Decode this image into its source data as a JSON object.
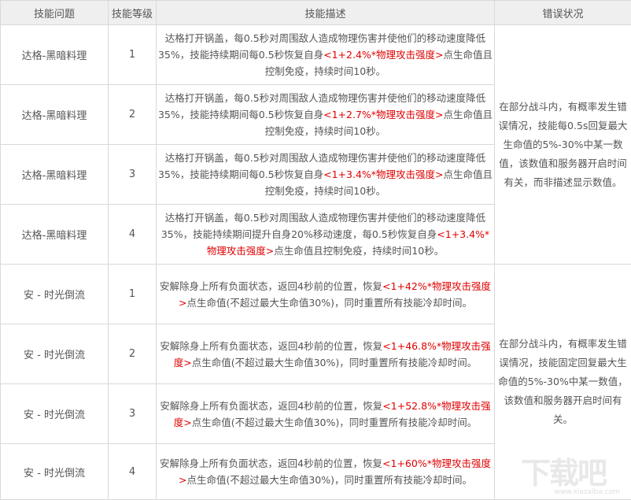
{
  "headers": [
    "技能问题",
    "技能等级",
    "技能描述",
    "错误状况"
  ],
  "groups": [
    {
      "issue": "在部分战斗内，有概率发生错误情况，技能每0.5s回复最大生命值的5%-30%中某一数值，该数值和服务器开启时间有关，而非描述显示数值。",
      "rows": [
        {
          "skill": "达格-黑暗料理",
          "level": "1",
          "desc_pre": "达格打开锅盖，每0.5秒对周围敌人造成物理伤害并使他们的移动速度降低35%，技能持续期间每0.5秒恢复自身",
          "desc_red": "<1+2.4%*物理攻击强度>",
          "desc_post": "点生命值且控制免疫，持续时间10秒。"
        },
        {
          "skill": "达格-黑暗料理",
          "level": "2",
          "desc_pre": "达格打开锅盖，每0.5秒对周围敌人造成物理伤害并使他们的移动速度降低35%，技能持续期间每0.5秒恢复自身",
          "desc_red": "<1+2.7%*物理攻击强度>",
          "desc_post": "点生命值且控制免疫，持续时间10秒。"
        },
        {
          "skill": "达格-黑暗料理",
          "level": "3",
          "desc_pre": "达格打开锅盖，每0.5秒对周围敌人造成物理伤害并使他们的移动速度降低35%，技能持续期间每0.5秒恢复自身",
          "desc_red": "<1+3.4%*物理攻击强度>",
          "desc_post": "点生命值且控制免疫，持续时间10秒。"
        },
        {
          "skill": "达格-黑暗料理",
          "level": "4",
          "desc_pre": "达格打开锅盖，每0.5秒对周围敌人造成物理伤害并使他们的移动速度降低35%，技能持续期间提升自身20%移动速度，每0.5秒恢复自身",
          "desc_red": "<1+3.4%*物理攻击强度>",
          "desc_post": "点生命值且控制免疫，持续时间10秒。"
        }
      ]
    },
    {
      "issue": "在部分战斗内，有概率发生错误情况，技能固定回复最大生命值的5%-30%中某一数值，该数值和服务器开启时间有关。",
      "rows": [
        {
          "skill": "安 - 时光倒流",
          "level": "1",
          "desc_pre": "安解除身上所有负面状态，返回4秒前的位置，恢复",
          "desc_red": "<1+42%*物理攻击强度>",
          "desc_post": "点生命值(不超过最大生命值30%)，同时重置所有技能冷却时间。"
        },
        {
          "skill": "安 - 时光倒流",
          "level": "2",
          "desc_pre": "安解除身上所有负面状态，返回4秒前的位置，恢复",
          "desc_red": "<1+46.8%*物理攻击强度>",
          "desc_post": "点生命值(不超过最大生命值30%)，同时重置所有技能冷却时间。"
        },
        {
          "skill": "安 - 时光倒流",
          "level": "3",
          "desc_pre": "安解除身上所有负面状态，返回4秒前的位置，恢复",
          "desc_red": "<1+52.8%*物理攻击强度>",
          "desc_post": "点生命值(不超过最大生命值30%)，同时重置所有技能冷却时间。"
        },
        {
          "skill": "安 - 时光倒流",
          "level": "4",
          "desc_pre": "安解除身上所有负面状态，返回4秒前的位置，恢复",
          "desc_red": "<1+60%*物理攻击强度>",
          "desc_post": "点生命值(不超过最大生命值30%)，同时重置所有技能冷却时间。"
        }
      ]
    }
  ],
  "watermark": "下载吧",
  "watermark_url": "www.xiazaiba.com",
  "colors": {
    "highlight": "#e00000",
    "header_bg": "#efefef",
    "border": "#d9d9d9",
    "text": "#555555"
  }
}
